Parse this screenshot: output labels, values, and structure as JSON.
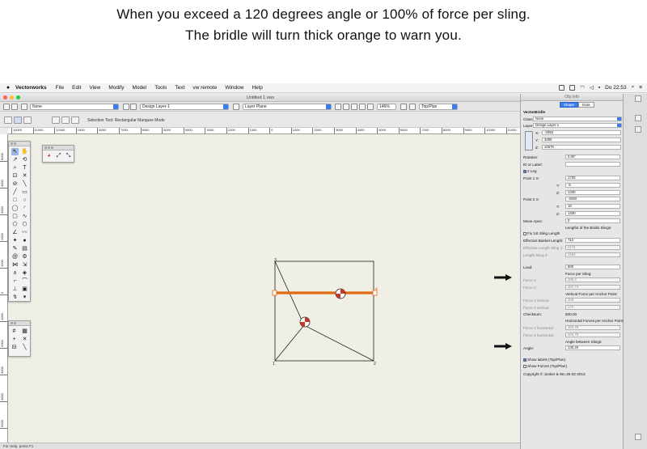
{
  "caption": {
    "line1": "When you exceed a 120 degrees angle or 100% of force per sling.",
    "line2": "The bridle will turn thick orange to warn you."
  },
  "menubar": {
    "app_name": "Vectorworks",
    "items": [
      "File",
      "Edit",
      "View",
      "Modify",
      "Model",
      "Tools",
      "Text",
      "vw remote",
      "Window",
      "Help"
    ],
    "clock": "Do 22:53"
  },
  "window": {
    "title": "Untitled 1.vwx",
    "class_value": "None",
    "layer_value": "Design Layer-1",
    "layer_plane": "Layer Plane",
    "zoom": "146%",
    "view": "Top/Plan",
    "mode_label": "Selection Tool: Rectangular Marquee Mode"
  },
  "ruler_h": [
    "10000",
    "11000",
    "12000",
    "1000",
    "8000",
    "7000",
    "6000",
    "5000",
    "4000",
    "3000",
    "2000",
    "1000",
    "0",
    "1000",
    "2000",
    "3000",
    "4000",
    "5000",
    "6000",
    "7000",
    "8000",
    "9000",
    "10000",
    "11000"
  ],
  "ruler_v": [
    "5000",
    "4000",
    "3000",
    "2000",
    "1000",
    "0",
    "1000",
    "2000",
    "3000",
    "4000",
    "5000",
    "6000"
  ],
  "status": "For Help, press F1",
  "drawing": {
    "corner_labels": [
      "3",
      "4",
      "1",
      "2"
    ],
    "bridle_color": "#e06a12"
  },
  "oip": {
    "title": "Obj Info",
    "tabs": [
      "Shape",
      "Data"
    ],
    "object_type": "VectorBridle",
    "class_label": "Class:",
    "class_value": "None",
    "layer_label": "Layer:",
    "layer_value": "Design Layer-1",
    "x_label": "X:",
    "x_value": "-2093",
    "y_label": "Y:",
    "y_value": "3405",
    "z_label": "Z:",
    "z_value": "10670",
    "rotation_label": "Rotation:",
    "rotation_value": "0,00°",
    "id_label": "ID or Label:",
    "two_leg_label": "2 Leg",
    "p1x_label": "Point 1 X:",
    "p1x_value": "1720",
    "p1y_label": "Y:",
    "p1y_value": "-5",
    "p1z_label": "Z:",
    "p1z_value": "1330",
    "p2x_label": "Point 2 X:",
    "p2x_value": "-3260",
    "p2y_label": "Y:",
    "p2y_value": "10",
    "p2z_label": "Z:",
    "p2z_value": "1330",
    "move_apex_label": "Move Apex:",
    "move_apex_value": "0",
    "lengths_heading": "Lengths of the Bridle Slings:",
    "fix_first_label": "Fix 1st Sling Length",
    "eff_label": "Effective Basket Length:",
    "eff_value": "712",
    "sling1_label": "Effective Length Sling 1:",
    "sling1_value": "2174",
    "sling2_label": "Length Sling 2:",
    "sling2_value": "3434",
    "load_label": "Load:",
    "load_value": "500",
    "fps_heading": "Force per Sling:",
    "force1_label": "Force 1:",
    "force1_value": "336,2",
    "force2_label": "Force 2:",
    "force2_value": "467,73",
    "vert_heading": "Vertical Force per Anchor Point:",
    "fv1_label": "Force 1 vertical:",
    "fv1_value": "328",
    "fv2_label": "Force 2 vertical:",
    "fv2_value": "172",
    "checksum_label": "Checksum:",
    "checksum_value": "500,00",
    "horiz_heading": "Horizontal Forces per Anchor Point:",
    "fh1_label": "Force 1 horizontal:",
    "fh1_value": "404,78",
    "fh2_label": "Force 2 horizontal:",
    "fh2_value": "404,78",
    "angle_heading": "Angle between Slings:",
    "angle_label": "Angle:",
    "angle_value": "130,20",
    "show_labels": "Show labels (Top/Plan)",
    "show_forces": "Show Forces (Top/Plan)",
    "copyright": "Copyright © Jonker & Wu 25-02-2013"
  }
}
